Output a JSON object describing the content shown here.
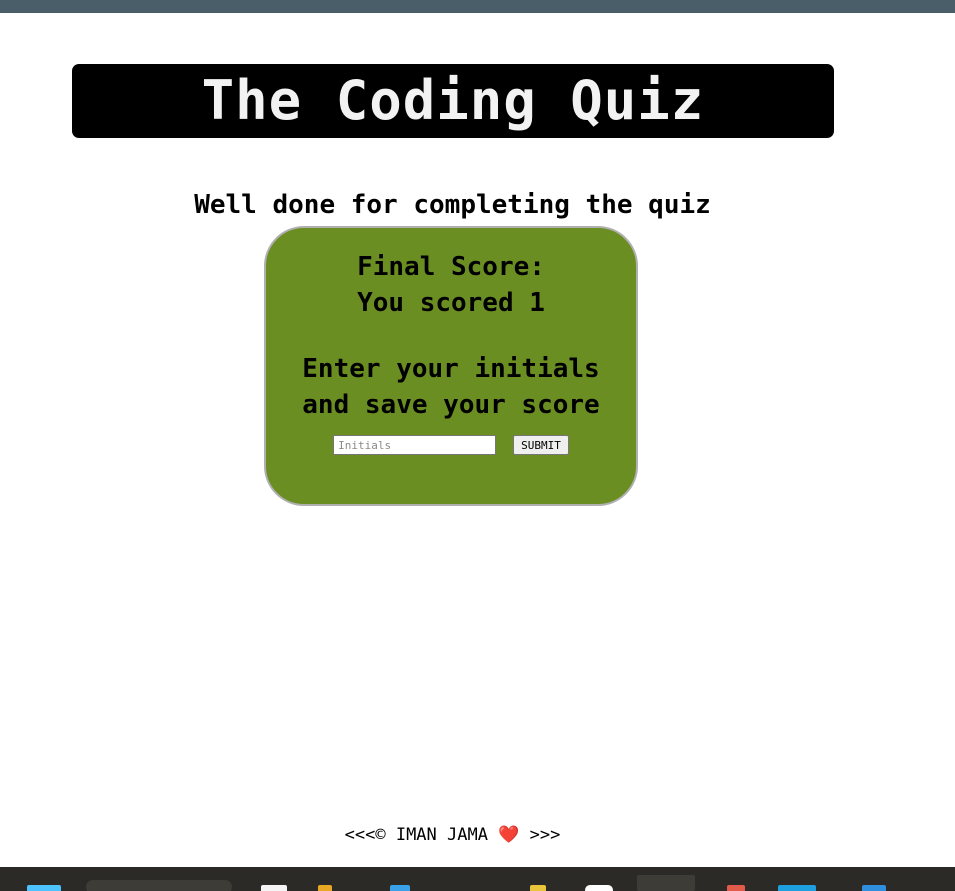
{
  "header": {
    "title": "The Coding Quiz"
  },
  "main": {
    "subtitle": "Well done for completing the quiz",
    "score_card": {
      "final_score_label": "Final Score:",
      "score_text": "You scored 1",
      "instruction_line1": "Enter your initials",
      "instruction_line2": "and save your score",
      "initials_placeholder": "Initials",
      "submit_label": "SUBMIT"
    }
  },
  "footer": {
    "prefix": "<<<© IMAN JAMA",
    "heart": "❤️",
    "suffix": ">>>"
  },
  "colors": {
    "card_background": "#6b8e23",
    "header_background": "#000000",
    "top_bar": "#4a5e6a",
    "taskbar": "#2b2a26"
  }
}
